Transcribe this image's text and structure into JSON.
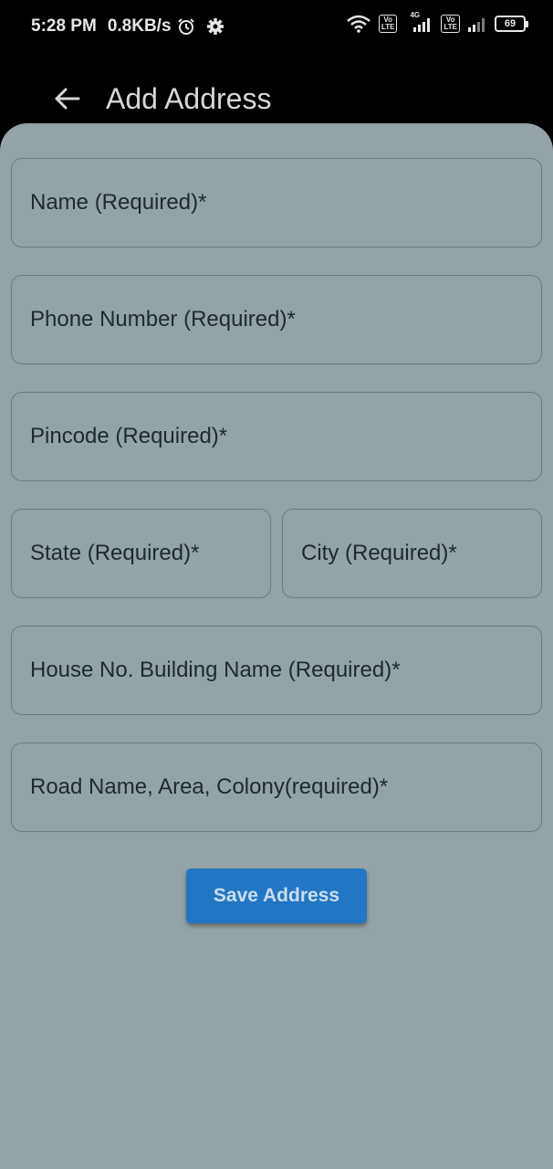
{
  "status_bar": {
    "time": "5:28 PM",
    "speed": "0.8KB/s",
    "network_type": "4G",
    "volte_label": "Vo LTE",
    "battery": "69",
    "icons": [
      "alarm-icon",
      "gear-icon",
      "wifi-icon",
      "volte-icon",
      "signal-icon",
      "volte-icon",
      "signal-icon",
      "battery-icon"
    ]
  },
  "app_bar": {
    "title": "Add Address",
    "back_icon": "arrow-left-icon"
  },
  "form": {
    "name_placeholder": "Name (Required)*",
    "phone_placeholder": "Phone Number (Required)*",
    "pincode_placeholder": "Pincode (Required)*",
    "state_placeholder": "State (Required)*",
    "city_placeholder": "City (Required)*",
    "house_placeholder": "House No. Building Name (Required)*",
    "road_placeholder": "Road Name, Area, Colony(required)*",
    "save_label": "Save Address"
  },
  "colors": {
    "background": "#000000",
    "sheet": "#93a3a7",
    "field_border": "#6d7b7e",
    "button": "#2376c4",
    "button_text": "#c9ddef"
  }
}
